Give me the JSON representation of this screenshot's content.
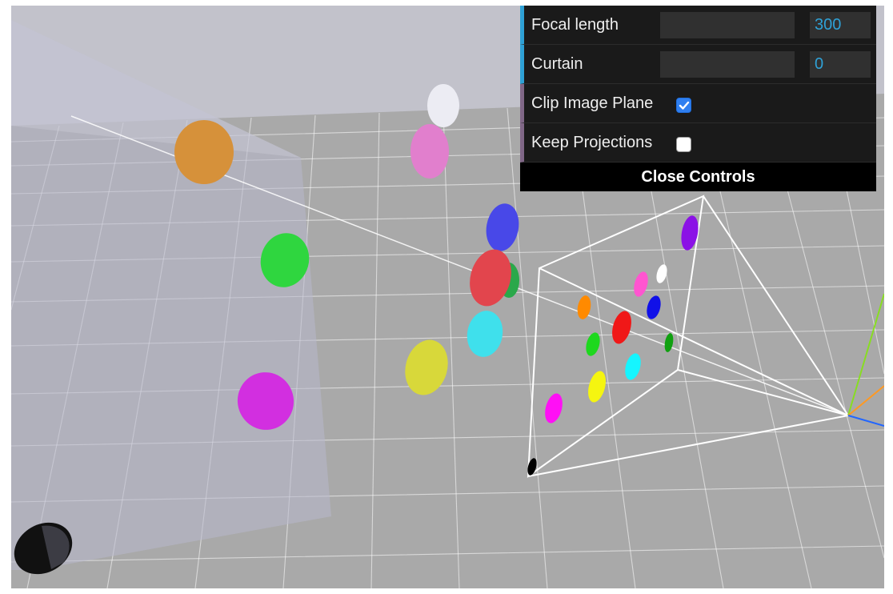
{
  "controls": {
    "focal_length": {
      "label": "Focal length",
      "value": "300"
    },
    "curtain": {
      "label": "Curtain",
      "value": "0"
    },
    "clip_image_plane": {
      "label": "Clip Image Plane",
      "checked": true
    },
    "keep_projections": {
      "label": "Keep Projections",
      "checked": false
    },
    "close_label": "Close Controls"
  },
  "colors": {
    "accent_number": "#2fa1d6",
    "accent_boolean": "#806787",
    "panel_bg": "#1a1a1a",
    "checkbox_on": "#2f7ff0"
  },
  "scene": {
    "balls": [
      {
        "name": "orange-ball",
        "color": "#d6913a"
      },
      {
        "name": "white-ball",
        "color": "#ececf3"
      },
      {
        "name": "pink-ball",
        "color": "#e17fcd"
      },
      {
        "name": "blue-ball",
        "color": "#4848e8"
      },
      {
        "name": "green-ball-far",
        "color": "#2aa84a"
      },
      {
        "name": "red-ball",
        "color": "#e2454d"
      },
      {
        "name": "green-ball",
        "color": "#2fd63f"
      },
      {
        "name": "cyan-ball",
        "color": "#3fe0ec"
      },
      {
        "name": "yellow-ball",
        "color": "#d8d83a"
      },
      {
        "name": "magenta-ball",
        "color": "#d22fe0"
      },
      {
        "name": "black-ball",
        "color": "#111111"
      }
    ],
    "projections": [
      {
        "name": "projection-purple",
        "color": "#8b12e6"
      },
      {
        "name": "projection-pink",
        "color": "#ff55d0"
      },
      {
        "name": "projection-white",
        "color": "#ffffff"
      },
      {
        "name": "projection-orange",
        "color": "#ff8a00"
      },
      {
        "name": "projection-blue",
        "color": "#1010e8"
      },
      {
        "name": "projection-red",
        "color": "#f01818"
      },
      {
        "name": "projection-green",
        "color": "#1ed81e"
      },
      {
        "name": "projection-green-small",
        "color": "#10a010"
      },
      {
        "name": "projection-cyan",
        "color": "#15f5ff"
      },
      {
        "name": "projection-yellow",
        "color": "#f5f510"
      },
      {
        "name": "projection-magenta",
        "color": "#ff10f5"
      },
      {
        "name": "projection-black",
        "color": "#000000"
      }
    ]
  }
}
